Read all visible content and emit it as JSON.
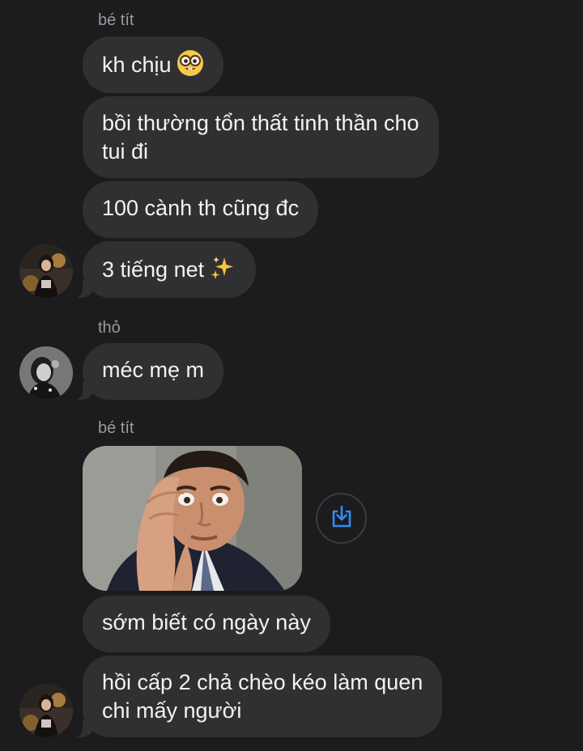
{
  "conversation": {
    "senders": {
      "first": "bé tít",
      "second": "thỏ",
      "third": "bé tít"
    },
    "messages": {
      "m1": "kh chịu",
      "m2": "bồi thường tổn thất tinh thần cho\ntui đi",
      "m3": "100 cành th cũng đc",
      "m4": "3 tiếng net",
      "m5": "méc mẹ m",
      "m6": "sớm biết có ngày này",
      "m7": "hồi cấp 2 chả chèo kéo làm quen\nchi mấy người"
    },
    "emoji": {
      "m1": "nerd-face",
      "m4": "sparkles"
    },
    "photo": {
      "subject": "man-facepalm-worried-reaction"
    },
    "actions": {
      "save_icon": "share-download-icon"
    }
  },
  "colors": {
    "background": "#1c1c1e",
    "bubble": "#303033",
    "bubble_text": "#f2f2f4",
    "sender_name": "#9a9a9e",
    "accent": "#2f8df5"
  }
}
